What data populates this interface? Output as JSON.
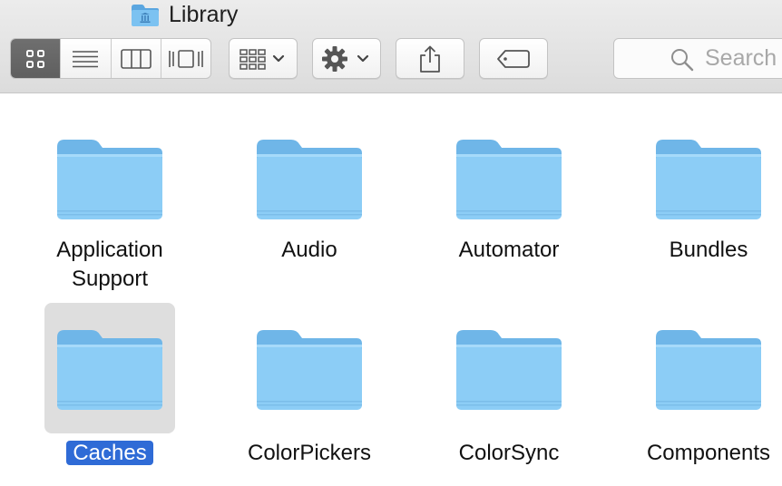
{
  "window": {
    "title": "Library"
  },
  "toolbar": {
    "view_modes": [
      {
        "name": "icon-view",
        "active": true
      },
      {
        "name": "list-view",
        "active": false
      },
      {
        "name": "column-view",
        "active": false
      },
      {
        "name": "cover-flow-view",
        "active": false
      }
    ],
    "search": {
      "placeholder": "Search"
    }
  },
  "folders": [
    {
      "label_lines": [
        "Application",
        "Support"
      ],
      "selected": false
    },
    {
      "label_lines": [
        "Audio"
      ],
      "selected": false
    },
    {
      "label_lines": [
        "Automator"
      ],
      "selected": false
    },
    {
      "label_lines": [
        "Bundles"
      ],
      "selected": false
    },
    {
      "label_lines": [
        "Caches"
      ],
      "selected": true
    },
    {
      "label_lines": [
        "ColorPickers"
      ],
      "selected": false
    },
    {
      "label_lines": [
        "ColorSync"
      ],
      "selected": false
    },
    {
      "label_lines": [
        "Components"
      ],
      "selected": false
    }
  ],
  "colors": {
    "folder_body": "#8cccf5",
    "folder_tab": "#6fb6e8",
    "selection_highlight": "#2f6bd6"
  }
}
